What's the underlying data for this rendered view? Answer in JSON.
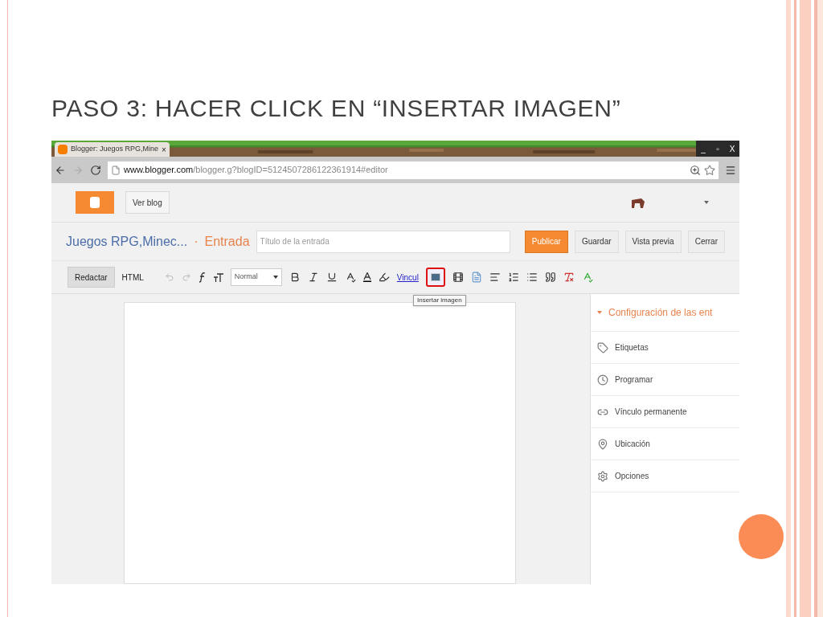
{
  "slide": {
    "title": "PASO 3: HACER CLICK EN “INSERTAR IMAGEN”"
  },
  "browser": {
    "tab_title": "Blogger: Juegos RPG,Mine",
    "tab_close": "×",
    "controls": [
      "_",
      "▫",
      "X"
    ],
    "url_host": "www.blogger.com",
    "url_path": "/blogger.g?blogID=5124507286122361914#editor"
  },
  "header": {
    "view_blog": "Ver blog"
  },
  "post_bar": {
    "blog_name": "Juegos RPG,Minec...",
    "separator": "·",
    "section": "Entrada",
    "title_placeholder": "Título de la entrada",
    "buttons": [
      {
        "label": "Publicar",
        "kind": "primary"
      },
      {
        "label": "Guardar",
        "kind": "plain"
      },
      {
        "label": "Vista previa",
        "kind": "plain"
      },
      {
        "label": "Cerrar",
        "kind": "plain"
      }
    ]
  },
  "toolbar": {
    "modes": [
      {
        "label": "Redactar",
        "selected": true
      },
      {
        "label": "HTML",
        "selected": false
      }
    ],
    "format": "Normal",
    "link": "Vincul",
    "insert_image": {
      "highlighted": true,
      "tooltip": "Insertar imagen"
    }
  },
  "sidebar": {
    "header": {
      "label": "Configuración de las ent",
      "expanded": true
    },
    "items": [
      {
        "label": "Etiquetas",
        "kind": "labels"
      },
      {
        "label": "Programar",
        "kind": "schedule"
      },
      {
        "label": "Vínculo permanente",
        "kind": "permalink"
      },
      {
        "label": "Ubicación",
        "kind": "location"
      },
      {
        "label": "Opciones",
        "kind": "options"
      }
    ]
  }
}
